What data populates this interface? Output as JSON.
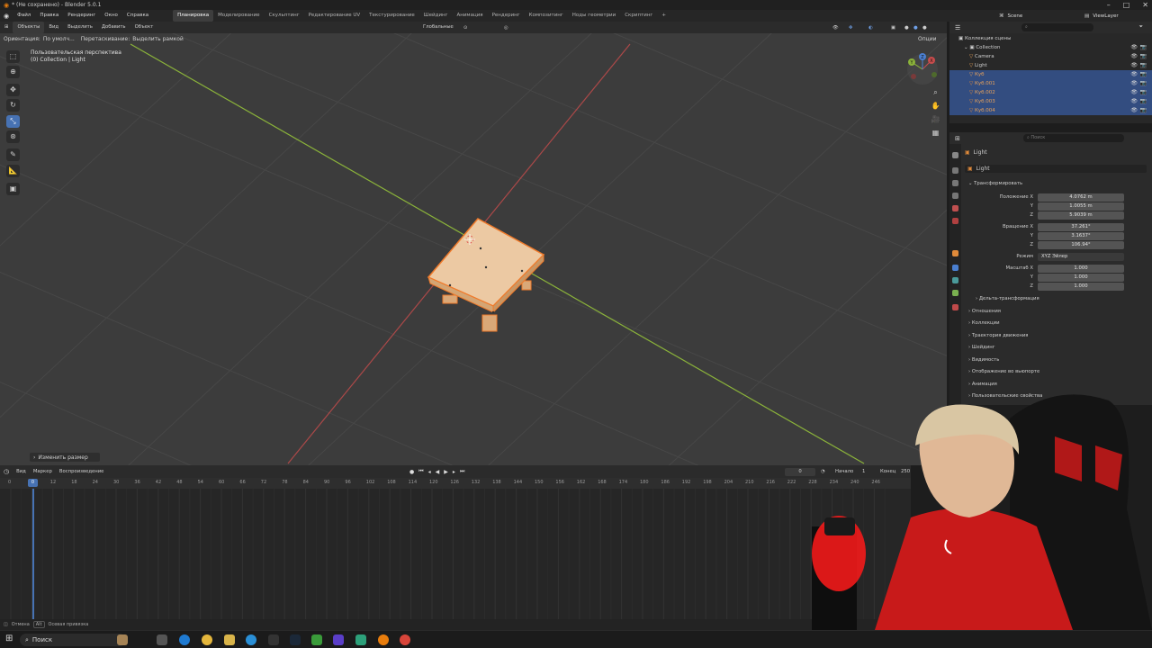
{
  "window": {
    "title": "* (Не сохранено) - Blender 5.0.1",
    "controls": [
      "–",
      "□",
      "✕"
    ]
  },
  "menu": {
    "items": [
      "Файл",
      "Правка",
      "Рендеринг",
      "Окно",
      "Справка"
    ],
    "workspaces": [
      "Планировка",
      "Моделирование",
      "Скульптинг",
      "Редактирование UV",
      "Текстурирование",
      "Шейдинг",
      "Анимация",
      "Рендеринг",
      "Композитинг",
      "Ноды геометрии",
      "Скриптинг"
    ],
    "active_workspace": "Планировка",
    "add_tab": "+",
    "scene": "Scene",
    "view_layer": "ViewLayer"
  },
  "viewport_header": {
    "mode": "Объекты",
    "view": "Вид",
    "select": "Выделить",
    "add": "Добавить",
    "object": "Объект",
    "transform_orientation": "Глобальные",
    "options": "Опции",
    "orientation_label": "Ориентация:",
    "orientation_value": "По умолч...",
    "drag_label": "Перетаскивание:",
    "drag_value": "Выделить рамкой"
  },
  "viewport": {
    "view_name": "Пользовательская перспектива",
    "collection_info": "(0) Collection | Light",
    "last_op": "Изменить размер",
    "gizmo_labels": [
      "X",
      "Y",
      "Z"
    ]
  },
  "timeline": {
    "menus": [
      "Вид",
      "Маркер",
      "Воспроизведение"
    ],
    "current_frame": "0",
    "start_label": "Начало",
    "start": "1",
    "end_label": "Конец",
    "end": "250",
    "ruler": [
      "0",
      "6",
      "12",
      "18",
      "24",
      "30",
      "36",
      "42",
      "48",
      "54",
      "60",
      "66",
      "72",
      "78",
      "84",
      "90",
      "96",
      "102",
      "108",
      "114",
      "120",
      "126",
      "132",
      "138",
      "144",
      "150",
      "156",
      "162",
      "168",
      "174",
      "180",
      "186",
      "192",
      "198",
      "204",
      "210",
      "216",
      "222",
      "228",
      "234",
      "240",
      "246"
    ]
  },
  "statusbar": {
    "cancel": "Отмена",
    "alt_hint": "Alt",
    "snap": "Осевая привязка"
  },
  "taskbar": {
    "search": "Поиск"
  },
  "outliner": {
    "root": "Коллекция сцены",
    "collection": "Collection",
    "items": [
      {
        "name": "Camera",
        "selected": false,
        "color": "#e6a15b"
      },
      {
        "name": "Light",
        "selected": false,
        "color": "#e6a15b"
      },
      {
        "name": "Куб",
        "selected": true,
        "color": "#e6a15b"
      },
      {
        "name": "Куб.001",
        "selected": true,
        "color": "#e08a3a"
      },
      {
        "name": "Куб.002",
        "selected": true,
        "color": "#e08a3a"
      },
      {
        "name": "Куб.003",
        "selected": true,
        "color": "#e08a3a"
      },
      {
        "name": "Куб.004",
        "selected": true,
        "color": "#e08a3a"
      }
    ]
  },
  "properties": {
    "search_placeholder": "Поиск",
    "object_name": "Light",
    "object_field": "Light",
    "transform_section": "Трансформировать",
    "location_label": "Положение X",
    "location": [
      "4.0762 m",
      "1.0055 m",
      "5.9039 m"
    ],
    "rotation_label": "Вращение X",
    "rotation": [
      "37.261°",
      "3.1637°",
      "106.94°"
    ],
    "axis_y": "Y",
    "axis_z": "Z",
    "mode_label": "Режим",
    "mode_value": "XYZ Эйлер",
    "scale_label": "Масштаб X",
    "scale": [
      "1.000",
      "1.000",
      "1.000"
    ],
    "delta": "Дельта-трансформация",
    "sections": [
      "Отношения",
      "Коллекции",
      "Траектория движения",
      "Шейдинг",
      "Видимость",
      "Отображение во вьюпорте",
      "Анимация",
      "Пользовательские свойства"
    ]
  },
  "colors": {
    "accent": "#4772b3",
    "selected_row": "#334d80",
    "x_axis": "#c84c4c",
    "y_axis": "#8bb33a",
    "table": "#ecc9a3"
  }
}
